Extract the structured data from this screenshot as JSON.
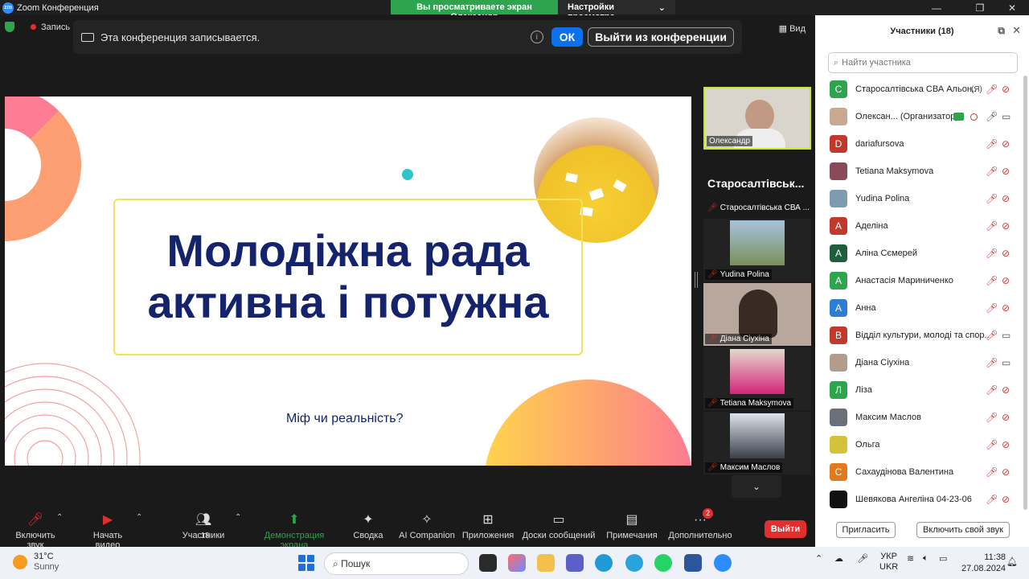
{
  "titlebar": {
    "app_title": "Zoom Конференция",
    "view_banner": "Вы просматриваете экран Олександр",
    "view_options": "Настройки просмотра",
    "minimize_icon": "minimize-icon",
    "maximize_icon": "maximize-icon",
    "close_icon": "close-icon"
  },
  "meeting_top": {
    "record_label": "Запись",
    "view_label": "Вид"
  },
  "recording_banner": {
    "text": "Эта конференция записывается.",
    "ok_label": "ОК",
    "leave_label": "Выйти из конференции"
  },
  "slide": {
    "title_line1": "Молодіжна рада",
    "title_line2": "активна і потужна",
    "subtitle": "Міф чи реальність?"
  },
  "thumbnails": {
    "speaker_name": "Олександр",
    "big_label": "Старосалтівськ...",
    "tiles": [
      {
        "name": "Старосалтівська СВА ..."
      },
      {
        "name": "Yudina Polina"
      },
      {
        "name": "Діана Сіухіна"
      },
      {
        "name": "Tetiana Maksymova"
      },
      {
        "name": "Максим Маслов"
      }
    ]
  },
  "toolbar": {
    "unmute": "Включить звук",
    "start_video": "Начать видео",
    "participants": "Участники",
    "participants_count": "18",
    "share": "Демонстрация экрана",
    "summary": "Сводка",
    "ai": "AI Companion",
    "apps": "Приложения",
    "whiteboards": "Доски сообщений",
    "notes": "Примечания",
    "more": "Дополнительно",
    "more_badge": "2",
    "end": "Выйти"
  },
  "panel": {
    "title": "Участники (18)",
    "search_placeholder": "Найти участника",
    "invite": "Пригласить",
    "unmute_me": "Включить свой звук",
    "me_tag": "(Я)",
    "participants": [
      {
        "initial": "С",
        "color": "#2ea44f",
        "name": "Старосалтівська СВА Альон...",
        "me": true,
        "mic": "muted",
        "cam": "off"
      },
      {
        "initial": "",
        "color": "#c9a98f",
        "name": "Олексан... (Организатор)",
        "host": true,
        "mic": "on",
        "cam": "on"
      },
      {
        "initial": "D",
        "color": "#c0392b",
        "name": "dariafursova",
        "mic": "muted",
        "cam": "off"
      },
      {
        "initial": "",
        "color": "#8a4a57",
        "name": "Tetiana Maksymova",
        "mic": "muted",
        "cam": "off"
      },
      {
        "initial": "",
        "color": "#7f9bb0",
        "name": "Yudina Polina",
        "mic": "muted",
        "cam": "off"
      },
      {
        "initial": "А",
        "color": "#c0392b",
        "name": "Аделіна",
        "mic": "muted",
        "cam": "off"
      },
      {
        "initial": "А",
        "color": "#1e5e3a",
        "name": "Аліна Сємерей",
        "mic": "muted",
        "cam": "off"
      },
      {
        "initial": "А",
        "color": "#2ea44f",
        "name": "Анастасія Мариниченко",
        "mic": "muted",
        "cam": "off"
      },
      {
        "initial": "А",
        "color": "#2d7dd2",
        "name": "Анна",
        "mic": "muted",
        "cam": "off"
      },
      {
        "initial": "В",
        "color": "#c0392b",
        "name": "Відділ культури, молоді та спор...",
        "mic": "muted",
        "cam": "on"
      },
      {
        "initial": "",
        "color": "#b39c8c",
        "name": "Діана Сіухіна",
        "mic": "muted",
        "cam": "on"
      },
      {
        "initial": "Л",
        "color": "#2ea44f",
        "name": "Ліза",
        "mic": "muted",
        "cam": "off"
      },
      {
        "initial": "",
        "color": "#6b6f7a",
        "name": "Максим Маслов",
        "mic": "muted",
        "cam": "off"
      },
      {
        "initial": "",
        "color": "#d6c23a",
        "name": "Ольга",
        "mic": "muted",
        "cam": "off"
      },
      {
        "initial": "С",
        "color": "#e07a1f",
        "name": "Сахаудінова Валентина",
        "mic": "muted",
        "cam": "off"
      },
      {
        "initial": "",
        "color": "#111111",
        "name": "Шевякова Ангеліна 04-23-06",
        "mic": "muted",
        "cam": "off"
      }
    ]
  },
  "taskbar": {
    "temp": "31°C",
    "weather": "Sunny",
    "search": "Пошук",
    "lang1": "УКР",
    "lang2": "UKR",
    "time": "11:38",
    "date": "27.08.2024"
  }
}
